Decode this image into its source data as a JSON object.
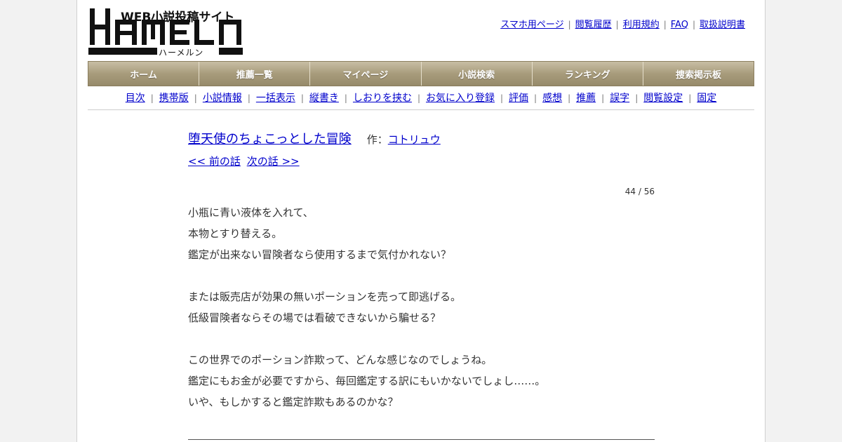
{
  "logo": {
    "tagline": "WEB小説投稿サイト",
    "wordmark": "HAMELN",
    "kana": "ハーメルン"
  },
  "top_links": [
    "スマホ用ページ",
    "閲覧履歴",
    "利用規約",
    "FAQ",
    "取扱説明書"
  ],
  "main_nav": [
    "ホーム",
    "推薦一覧",
    "マイページ",
    "小説検索",
    "ランキング",
    "捜索掲示板"
  ],
  "sub_nav": [
    "目次",
    "携帯版",
    "小説情報",
    "一括表示",
    "縦書き",
    "しおりを挟む",
    "お気に入り登録",
    "評価",
    "感想",
    "推薦",
    "誤字",
    "閲覧設定",
    "固定"
  ],
  "novel": {
    "title": "堕天使のちょこっとした冒険",
    "author_label": "作：",
    "author": "コトリュウ",
    "prev": "<< 前の話",
    "next": "次の話 >>",
    "pager": "44 / 56"
  },
  "body_lines": [
    "小瓶に青い液体を入れて、",
    "本物とすり替える。",
    "鑑定が出来ない冒険者なら使用するまで気付かれない？",
    "",
    "または販売店が効果の無いポーションを売って即逃げる。",
    "低級冒険者ならその場では看破できないから騙せる？",
    "",
    "この世界でのポーション詐欺って、どんな感じなのでしょうね。",
    "鑑定にもお金が必要ですから、毎回鑑定する訳にもいかないでしょし……。",
    "いや、もしかすると鑑定詐欺もあるのかな？"
  ],
  "colors": {
    "nav_top": "#c8bea4",
    "nav_bottom": "#968a6a",
    "link": "#0000cc",
    "page_bg": "#ffffff",
    "outer_bg": "#f2f2f2"
  }
}
